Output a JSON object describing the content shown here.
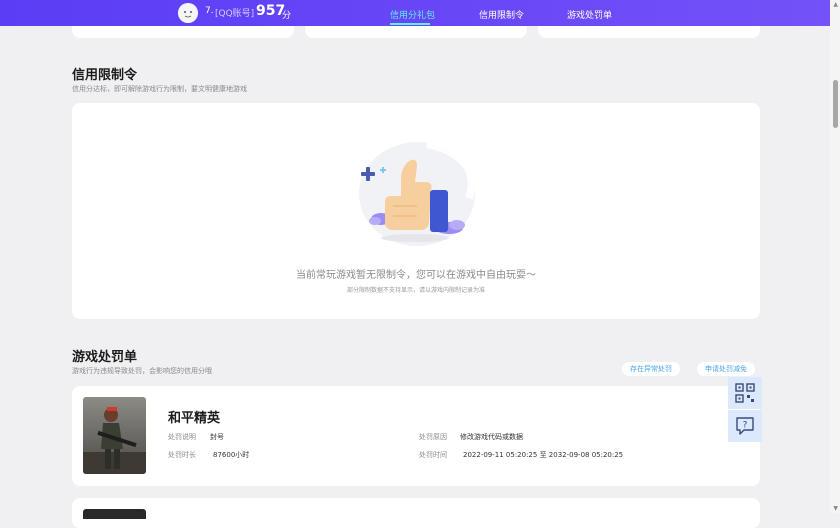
{
  "header": {
    "user_rank": "7.",
    "user_type": "[QQ账号]",
    "score": "957",
    "score_unit": "分",
    "tabs": [
      {
        "label": "信用分礼包",
        "active": true
      },
      {
        "label": "信用限制令",
        "active": false
      },
      {
        "label": "游戏处罚单",
        "active": false
      }
    ]
  },
  "restriction": {
    "title": "信用限制令",
    "subtitle": "信用分达标，即可解除游戏行为限制，要文明健康地游戏",
    "empty_main": "当前常玩游戏暂无限制令，您可以在游戏中自由玩耍～",
    "empty_sub": "部分限制数据不支持显示，请以游戏内限制记录为准"
  },
  "penalty": {
    "title": "游戏处罚单",
    "subtitle": "游戏行为违规导致处罚，会影响您的信用分哦",
    "btn_report": "存在异常处罚",
    "btn_appeal": "申请处罚减免",
    "items": [
      {
        "game": "和平精英",
        "desc_label": "处罚说明",
        "desc_value": "封号",
        "duration_label": "处罚时长",
        "duration_value": "87600小时",
        "reason_label": "处罚原因",
        "reason_value": "修改游戏代码或数据",
        "time_label": "处罚时间",
        "time_value": "2022-09-11 05:20:25 至 2032-09-08 05:20:25"
      }
    ]
  },
  "floating": {
    "icons": [
      "qrcode-icon",
      "help-feedback-icon"
    ]
  },
  "colors": {
    "accent": "#5b3df5",
    "active_tab": "#5cf3f0",
    "link": "#4aa6e8",
    "float_bg": "#dce8fb"
  }
}
